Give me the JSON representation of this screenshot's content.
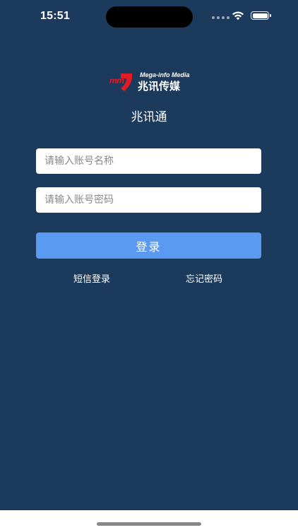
{
  "status_bar": {
    "time": "15:51",
    "signal_icon": "signal-dots-icon",
    "wifi_icon": "wifi-icon",
    "battery_icon": "battery-icon"
  },
  "logo": {
    "mark_text": "mm",
    "english_name": "Mega-info Media",
    "chinese_name": "兆讯传媒",
    "brand_red": "#e21b25"
  },
  "app": {
    "title": "兆讯通"
  },
  "form": {
    "username": {
      "value": "",
      "placeholder": "请输入账号名称"
    },
    "password": {
      "value": "",
      "placeholder": "请输入账号密码"
    },
    "login_label": "登录",
    "sms_login_label": "短信登录",
    "forgot_password_label": "忘记密码"
  },
  "colors": {
    "background": "#1c3a5c",
    "primary_button": "#5a9af0"
  }
}
